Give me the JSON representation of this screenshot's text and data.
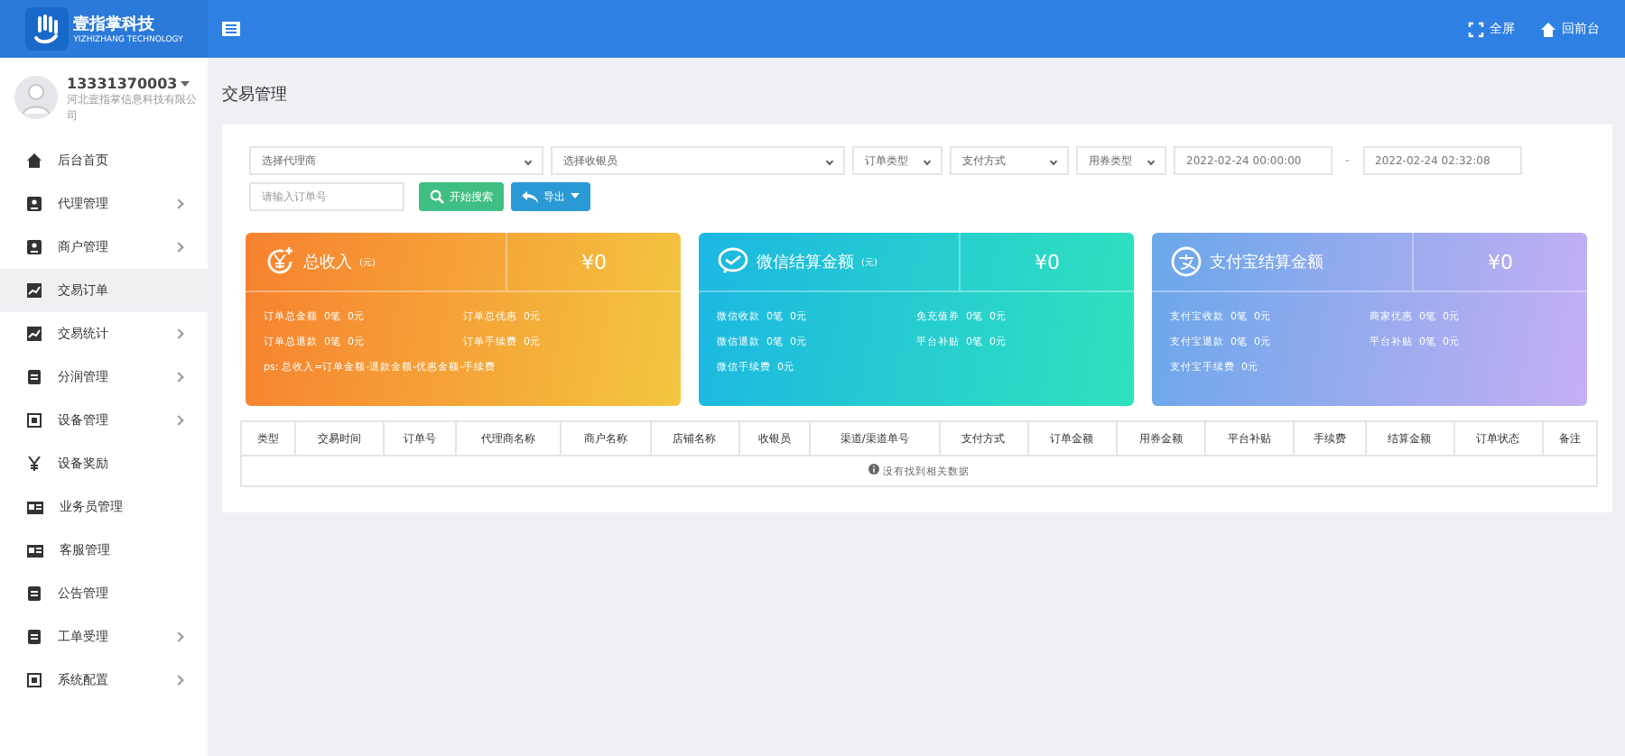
{
  "header": {
    "logo_title": "壹指掌科技",
    "logo_subtitle": "YIZHIZHANG TECHNOLOGY",
    "actions": [
      {
        "kind": "fullscreen",
        "label": "全屏"
      },
      {
        "kind": "home",
        "label": "回前台"
      }
    ]
  },
  "user": {
    "name": "13331370003",
    "company": "河北壹指掌信息科技有限公司"
  },
  "sidebar": {
    "items": [
      {
        "label": "后台首页",
        "has_children": false,
        "selected": false
      },
      {
        "label": "代理管理",
        "has_children": true,
        "selected": false
      },
      {
        "label": "商户管理",
        "has_children": true,
        "selected": false
      },
      {
        "label": "交易订单",
        "has_children": false,
        "selected": true
      },
      {
        "label": "交易统计",
        "has_children": true,
        "selected": false
      },
      {
        "label": "分润管理",
        "has_children": true,
        "selected": false
      },
      {
        "label": "设备管理",
        "has_children": true,
        "selected": false
      },
      {
        "label": "设备奖励",
        "has_children": false,
        "selected": false
      },
      {
        "label": "业务员管理",
        "has_children": false,
        "selected": false
      },
      {
        "label": "客服管理",
        "has_children": false,
        "selected": false
      },
      {
        "label": "公告管理",
        "has_children": false,
        "selected": false
      },
      {
        "label": "工单受理",
        "has_children": true,
        "selected": false
      },
      {
        "label": "系统配置",
        "has_children": true,
        "selected": false
      }
    ]
  },
  "page_title": "交易管理",
  "filters": {
    "selects": [
      {
        "value": "选择代理商"
      },
      {
        "value": "选择收银员"
      },
      {
        "value": "订单类型"
      },
      {
        "value": "支付方式"
      },
      {
        "value": "用券类型"
      }
    ],
    "date_from": "2022-02-24 00:00:00",
    "date_sep": "-",
    "date_to": "2022-02-24 02:32:08",
    "order_placeholder": "请输入订单号",
    "search_button": "开始搜索",
    "export_button": "导出"
  },
  "stat_cards": [
    {
      "kind": "income",
      "title": "总收入",
      "unit": "(元)",
      "value": "¥0",
      "lines": [
        {
          "label": "订单总金额",
          "values": [
            "0笔",
            "0元"
          ]
        },
        {
          "label": "订单总优惠",
          "values": [
            "0元"
          ]
        },
        {
          "label": "订单总退款",
          "values": [
            "0笔",
            "0元"
          ]
        },
        {
          "label": "订单手续费",
          "values": [
            "0元"
          ]
        }
      ],
      "note": "ps: 总收入=订单金额-退款金额-优惠金额-手续费"
    },
    {
      "kind": "wechat",
      "title": "微信结算金额",
      "unit": "(元)",
      "value": "¥0",
      "lines": [
        {
          "label": "微信收款",
          "values": [
            "0笔",
            "0元"
          ]
        },
        {
          "label": "免充值券",
          "values": [
            "0笔",
            "0元"
          ]
        },
        {
          "label": "微信退款",
          "values": [
            "0笔",
            "0元"
          ]
        },
        {
          "label": "平台补贴",
          "values": [
            "0笔",
            "0元"
          ]
        },
        {
          "label": "微信手续费",
          "values": [
            "0元"
          ]
        }
      ]
    },
    {
      "kind": "alipay",
      "title": "支付宝结算金额",
      "value": "¥0",
      "lines": [
        {
          "label": "支付宝收款",
          "values": [
            "0笔",
            "0元"
          ]
        },
        {
          "label": "商家优惠",
          "values": [
            "0笔",
            "0元"
          ]
        },
        {
          "label": "支付宝退款",
          "values": [
            "0笔",
            "0元"
          ]
        },
        {
          "label": "平台补贴",
          "values": [
            "0笔",
            "0元"
          ]
        },
        {
          "label": "支付宝手续费",
          "values": [
            "0元"
          ]
        }
      ]
    }
  ],
  "table": {
    "columns": [
      "类型",
      "交易时间",
      "订单号",
      "代理商名称",
      "商户名称",
      "店铺名称",
      "收银员",
      "渠道/渠道单号",
      "支付方式",
      "订单金额",
      "用券金额",
      "平台补贴",
      "手续费",
      "结算金额",
      "订单状态",
      "备注"
    ],
    "empty_message": "没有找到相关数据"
  }
}
